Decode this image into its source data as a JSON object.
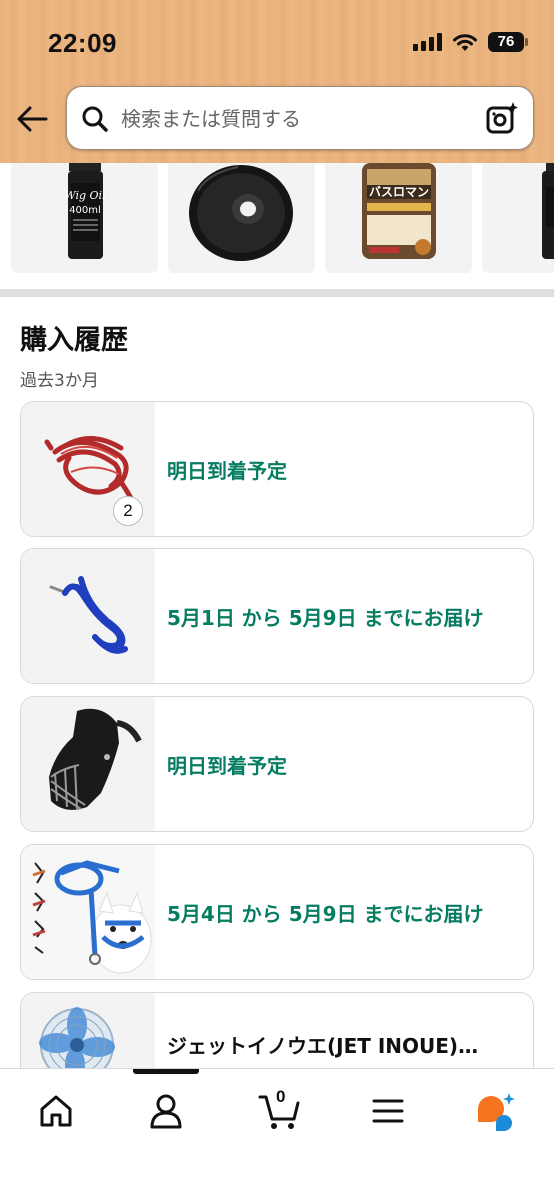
{
  "status_bar": {
    "time": "22:09",
    "battery": "76"
  },
  "search": {
    "placeholder": "検索または質問する"
  },
  "purchase_history": {
    "title": "購入履歴",
    "subtitle": "過去3か月",
    "orders": [
      {
        "status": "明日到着予定",
        "quantity": "2",
        "item": "red-rope"
      },
      {
        "status": "5月1日 から 5月9日 までにお届け",
        "item": "blue-rope"
      },
      {
        "status": "明日到着予定",
        "item": "wire-muzzle"
      },
      {
        "status": "5月4日 から 5月9日 までにお届け",
        "item": "dog-harness"
      },
      {
        "status": "ジェットイノウエ(JET INOUE)…",
        "item": "fan"
      }
    ]
  },
  "strip_products": [
    {
      "label_line1": "Wig Oil",
      "label_line2": "400ml"
    },
    {
      "label": "filament"
    },
    {
      "label": "バスロマン"
    },
    {
      "label": "partial"
    }
  ],
  "bottom_nav": {
    "cart_count": "0"
  },
  "colors": {
    "accent_green": "#067d62",
    "header_wood": "#e9b27d",
    "assistant_orange": "#f5741f",
    "assistant_blue": "#1a8cd8"
  }
}
